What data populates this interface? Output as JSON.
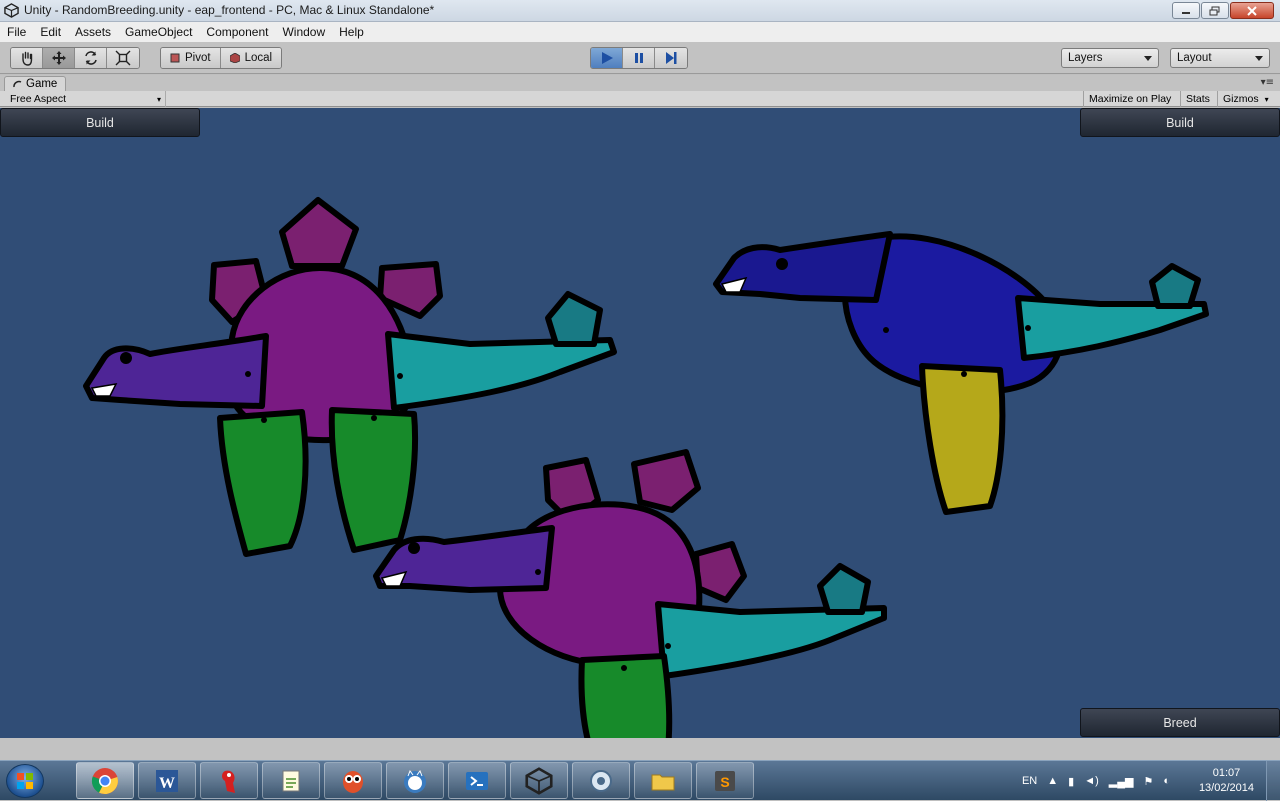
{
  "window": {
    "title": "Unity - RandomBreeding.unity - eap_frontend - PC, Mac & Linux Standalone*"
  },
  "menu": [
    "File",
    "Edit",
    "Assets",
    "GameObject",
    "Component",
    "Window",
    "Help"
  ],
  "toolbar": {
    "pivot_label": "Pivot",
    "local_label": "Local",
    "layers_label": "Layers",
    "layout_label": "Layout"
  },
  "game_tab": {
    "label": "Game",
    "aspect": "Free Aspect",
    "maximize_on_play": "Maximize on Play",
    "stats": "Stats",
    "gizmos": "Gizmos"
  },
  "game": {
    "build_left": "Build",
    "build_right": "Build",
    "breed": "Breed"
  },
  "taskbar": {
    "apps": [
      "chrome-icon",
      "word-icon",
      "parrot-icon",
      "notepad-icon",
      "owl-icon",
      "cat-icon",
      "powershell-icon",
      "unity-icon",
      "remote-icon",
      "folder-icon",
      "sublime-icon"
    ],
    "active_app": "chrome-icon",
    "language": "EN",
    "time": "01:07",
    "date": "13/02/2014"
  },
  "colors": {
    "background": "#304d76",
    "creature_body_purple": "#7a1a82",
    "creature_body_blue": "#1b1aa0",
    "neck_purple": "#4e2596",
    "tail_teal": "#199ea0",
    "leg_green": "#178a2a",
    "leg_yellow": "#b5a81a",
    "plate_purple": "#7b2070"
  }
}
